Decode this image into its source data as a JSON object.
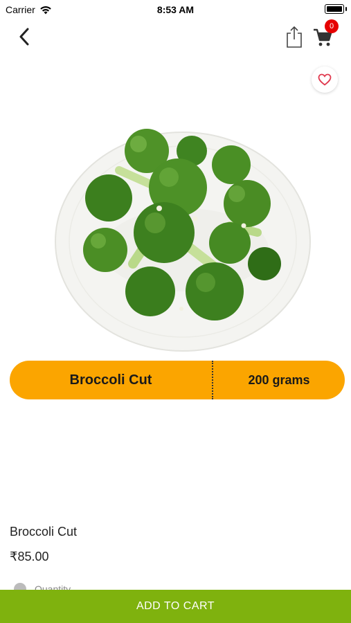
{
  "status_bar": {
    "carrier": "Carrier",
    "time": "8:53 AM"
  },
  "header": {
    "back_icon": "chevron-left-icon",
    "share_icon": "share-icon",
    "cart_icon": "cart-icon",
    "cart_count": "0",
    "badge_color": "#e60000"
  },
  "favorite": {
    "icon": "heart-icon",
    "color": "#e0394e"
  },
  "product": {
    "image_label": "Broccoli Cut",
    "pill_name": "Broccoli Cut",
    "pill_weight": "200 grams",
    "pill_color": "#fba500",
    "title": "Broccoli Cut",
    "price": "₹85.00",
    "quantity_label": "Quantity"
  },
  "footer": {
    "add_to_cart_label": "ADD TO CART",
    "button_color": "#7fb20e"
  }
}
